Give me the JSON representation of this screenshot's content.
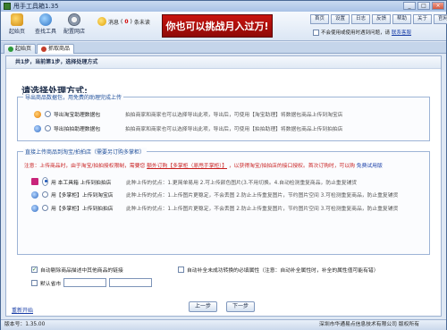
{
  "app": {
    "title": "甩手工具箱1.35"
  },
  "window_buttons": {
    "min": "_",
    "max": "□",
    "close": "×"
  },
  "toolbar": {
    "home": "起始页",
    "find": "查找工具",
    "config": "配置网店"
  },
  "messages": {
    "label": "消息",
    "open": "(",
    "count": "0",
    "close": ")",
    "unread": "条未读"
  },
  "banner": "你也可以挑战月入过万!",
  "top_buttons": [
    "首页",
    "设置",
    "日志",
    "反馈",
    "帮助",
    "关于",
    "官网"
  ],
  "top_option": {
    "label": "不会使用或使用时遇到问题，请",
    "link": "联系客服"
  },
  "tabs": [
    {
      "label": "起始页"
    },
    {
      "label": "抓取商品"
    }
  ],
  "steps": "共1步，当前第1步，选择处理方式",
  "heading": "请选择处理方式:",
  "group1": {
    "legend": "导出商品数据包，用免费的助理完成上传",
    "rows": [
      {
        "label": "导出淘宝助理数据包",
        "desc": "拍拍商家和商家也可以选择导出此项，导出后，可使用【淘宝助理】将数据包商品上传到淘宝店"
      },
      {
        "label": "导出拍拍助理数据包",
        "desc": "拍拍商家和商家也可以选择导出此项，导出后，可使用【拍拍助理】将数据包商品上传到拍拍店"
      }
    ]
  },
  "group2": {
    "legend": "直接上传商品到淘宝/拍拍店（需要另订购多掌柜）",
    "notice_a": "注意：上传商品时，由于淘宝/拍拍授权限制，需要您",
    "notice_link": "额外订购【多掌柜（原甩手掌柜）】",
    "notice_b": "，以获得淘宝/拍拍店的接口授权。首次订购时，可以购",
    "notice_free": "免费试用版",
    "rows": [
      {
        "label": "用 本工具箱 上传到拍拍店",
        "desc": "此种上传的优点：1.更简单易用 2.可上传颜色图片(3.不用切换。4.自动检测重复商品，防止重复铺货"
      },
      {
        "label": "用【多掌柜】上传到淘宝店",
        "desc": "此种上传的优点：1.上传图片更稳定，不会丢图 2.防止上传重复图片，节约图片空间 3.可检测重复商品，防止重复铺货"
      },
      {
        "label": "用【多掌柜】上传到拍拍店",
        "desc": "此种上传的优点：1.上传图片更稳定，不会丢图 2.防止上传重复图片，节约图片空间 3.可检测重复商品，防止重复铺货"
      }
    ]
  },
  "options": {
    "auto_exclude": "自动剔除商品描述中其他商品的链接",
    "auto_fill": "自动补全未成功转换的必填属性（注意：自动补全属性时，补全的属性值可能有错）",
    "default_city": "默认省市"
  },
  "bottom": {
    "reset": "重新开始",
    "prev": "上一步",
    "next": "下一步"
  },
  "status": {
    "version": "版本号：1.35.00",
    "copyright": "深圳市华通易点信息技术有限公司 版权所有"
  }
}
